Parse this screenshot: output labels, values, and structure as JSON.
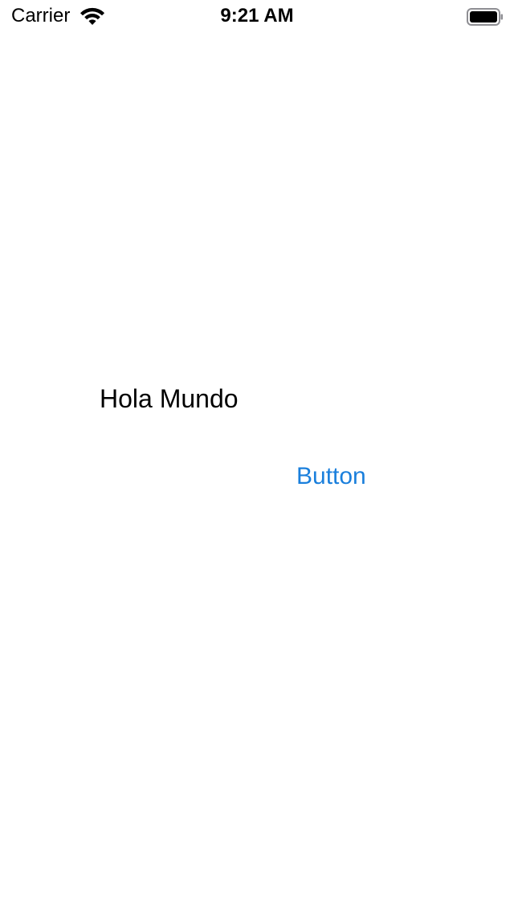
{
  "status_bar": {
    "carrier": "Carrier",
    "time": "9:21 AM",
    "wifi_icon": "wifi-icon",
    "battery_icon": "battery-full-icon"
  },
  "main": {
    "label_text": "Hola Mundo",
    "button_label": "Button",
    "button_color": "#1a7fdc"
  }
}
